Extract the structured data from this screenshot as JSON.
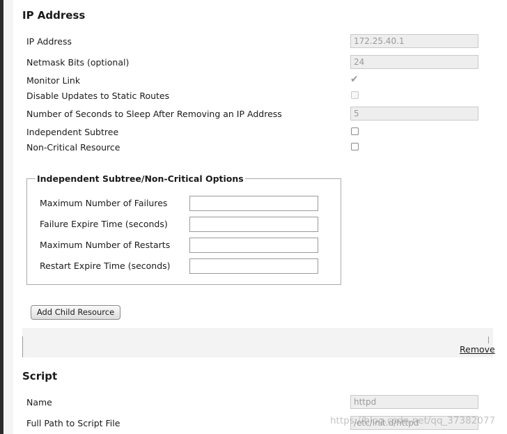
{
  "ip_section": {
    "title": "IP Address",
    "ip_address": {
      "label": "IP Address",
      "value": "172.25.40.1"
    },
    "netmask": {
      "label": "Netmask Bits (optional)",
      "value": "24"
    },
    "monitor_link": {
      "label": "Monitor Link",
      "checked": true
    },
    "disable_updates": {
      "label": "Disable Updates to Static Routes",
      "checked": false
    },
    "sleep_seconds": {
      "label": "Number of Seconds to Sleep After Removing an IP Address",
      "value": "5"
    },
    "independent_subtree": {
      "label": "Independent Subtree",
      "checked": false
    },
    "non_critical": {
      "label": "Non-Critical Resource",
      "checked": false
    }
  },
  "options": {
    "legend": "Independent Subtree/Non-Critical Options",
    "max_failures": {
      "label": "Maximum Number of Failures",
      "value": ""
    },
    "failure_expire": {
      "label": "Failure Expire Time (seconds)",
      "value": ""
    },
    "max_restarts": {
      "label": "Maximum Number of Restarts",
      "value": ""
    },
    "restart_expire": {
      "label": "Restart Expire Time (seconds)",
      "value": ""
    }
  },
  "add_child_label": "Add Child Resource",
  "remove_label": "Remove",
  "script_section": {
    "title": "Script",
    "name": {
      "label": "Name",
      "value": "httpd"
    },
    "path": {
      "label": "Full Path to Script File",
      "value": "/etc/init.d/httpd"
    }
  },
  "watermark": "https://blog.csdn.net/qq_37382077"
}
